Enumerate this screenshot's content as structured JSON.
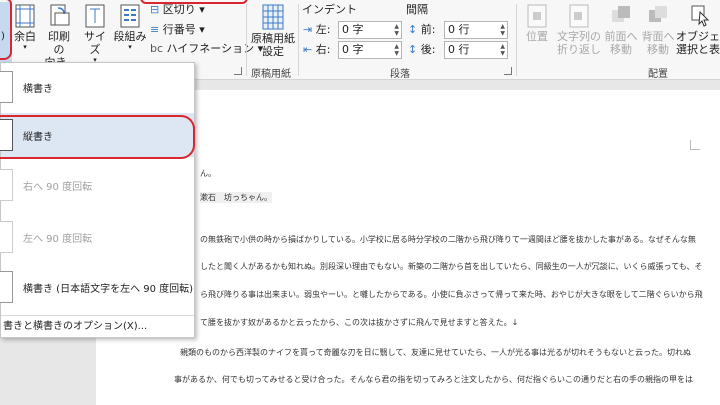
{
  "ribbon": {
    "margins": "余白",
    "print_direction": [
      "印刷の",
      "向き"
    ],
    "size": "サイズ",
    "columns": "段組み",
    "breaks": "区切り",
    "line_numbers": "行番号",
    "hyphenation": "ハイフネーション",
    "genko_button": [
      "原稿用紙",
      "設定"
    ],
    "genko_group": "原稿用紙",
    "indent_label": "インデント",
    "spacing_label": "間隔",
    "indent_left_label": "左:",
    "indent_left_value": "0 字",
    "indent_right_label": "右:",
    "indent_right_value": "0 字",
    "space_before_label": "前:",
    "space_before_value": "0 行",
    "space_after_label": "後:",
    "space_after_value": "0 行",
    "paragraph_group": "段落",
    "position": "位置",
    "wrap_text": [
      "文字列の",
      "折り返し"
    ],
    "bring_forward": [
      "前面へ",
      "移動"
    ],
    "send_backward": [
      "背面へ",
      "移動"
    ],
    "selection_pane": [
      "オブジェクトの",
      "選択と表示"
    ],
    "arrange_group": "配置"
  },
  "dropdown": {
    "items": [
      {
        "label": "横書き"
      },
      {
        "label": "縦書き"
      },
      {
        "label": "右へ 90 度回転"
      },
      {
        "label": "左へ 90 度回転"
      },
      {
        "label": "横書き (日本語文字を左へ 90 度回転)"
      }
    ],
    "footer": "書きと横書きのオプション(X)..."
  },
  "document": {
    "lines": [
      "ん。",
      "漱石　坊っちゃん。",
      "の無鉄砲で小供の時から損ばかりしている。小学校に居る時分学校の二階から飛び降りて一週間ほど腰を抜かした事がある。なぜそんな無",
      "したと聞く人があるかも知れぬ。別段深い理由でもない。新築の二階から首を出していたら、同級生の一人が冗談に、いくら威張っても、そ",
      "ら飛び降りる事は出来まい。弱虫やーい。と囃したからである。小使に負ぶさって帰って来た時、おやじが大きな眼をして二階ぐらいから飛",
      "て腰を抜かす奴があるかと云ったから、この次は抜かさずに飛んで見せますと答えた。↓",
      "親類のものから西洋製のナイフを貰って奇麗な刃を日に翳して、友達に見せていたら、一人が光る事は光るが切れそうもないと云った。切れぬ",
      "事があるか、何でも切ってみせると受け合った。そんなら君の指を切ってみろと注文したから、何だ指ぐらいこの通りだと右の手の親指の甲をは"
    ]
  }
}
